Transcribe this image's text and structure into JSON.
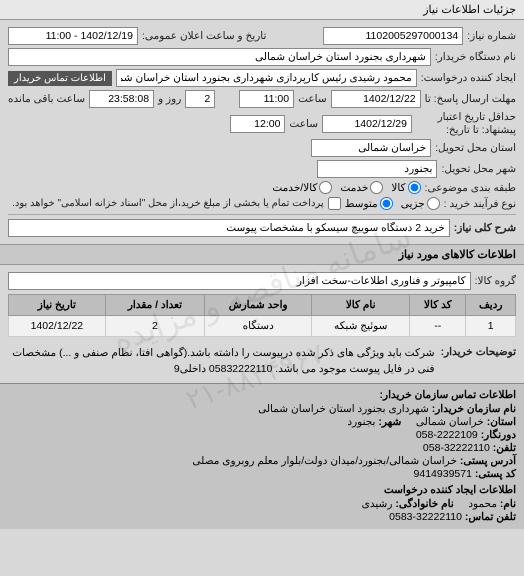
{
  "tab_title": "جزئیات اطلاعات نیاز",
  "header": {
    "num_label": "شماره نیاز:",
    "num_value": "1102005297000134",
    "announce_label": "تاریخ و ساعت اعلان عمومی:",
    "announce_value": "1402/12/19 - 11:00",
    "buyer_label": "نام دستگاه خریدار:",
    "buyer_value": "شهرداری بجنورد استان خراسان شمالی",
    "requester_label": "ایجاد کننده درخواست:",
    "requester_value": "محمود رشیدی رئیس کارپردازی شهرداری بجنورد استان خراسان شمالی",
    "contact_btn": "اطلاعات تماس خریدار",
    "deadline1_label": "مهلت ارسال پاسخ: تا",
    "deadline1_date": "1402/12/22",
    "time_label": "ساعت",
    "deadline1_time": "11:00",
    "remain_days": "2",
    "remain_days_label": "روز و",
    "remain_time": "23:58:08",
    "remain_time_label": "ساعت باقی مانده",
    "deadline2_label": "حداقل تاریخ اعتبار پیشنهاد: تا تاریخ:",
    "deadline2_date": "1402/12/29",
    "deadline2_time": "12:00",
    "province_label": "استان محل تحویل:",
    "province_value": "خراسان شمالی",
    "city_label": "شهر محل تحویل:",
    "city_value": "بجنورد",
    "subject_label": "طبقه بندی موضوعی:",
    "radio_goods": "کالا",
    "radio_service": "خدمت",
    "radio_both": "کالا/خدمت",
    "purchase_type_label": "نوع فرآیند خرید :",
    "radio_partial": "جزیی",
    "radio_medium": "متوسط",
    "purchase_note": "پرداخت تمام یا بخشی از مبلغ خرید،از محل \"اسناد خزانه اسلامی\" خواهد بود.",
    "need_desc_label": "شرح کلی نیاز:",
    "need_desc_value": "خرید 2 دستگاه سوییچ سیسکو با مشخصات پیوست"
  },
  "goods": {
    "section_title": "اطلاعات کالاهای مورد نیاز",
    "group_label": "گروه کالا:",
    "group_value": "کامپیوتر و فناوری اطلاعات-سخت افزار",
    "columns": [
      "ردیف",
      "کد کالا",
      "نام کالا",
      "واحد شمارش",
      "تعداد / مقدار",
      "تاریخ نیاز"
    ],
    "rows": [
      {
        "idx": "1",
        "code": "--",
        "name": "سوئیج شبکه",
        "unit": "دستگاه",
        "qty": "2",
        "date": "1402/12/22"
      }
    ],
    "notes_label": "توضیحات خریدار:",
    "notes_text": "شرکت باید ویژگی های ذکر شده درپیوست را داشته باشد.(گواهی افتا، نظام صنفی و ...) مشخصات فنی در فایل پیوست موجود می باشد. 05832222110 داخلی9"
  },
  "footer": {
    "org_title": "اطلاعات تماس سازمان خریدار:",
    "org_name_label": "نام سازمان خریدار:",
    "org_name": "شهرداری بجنورد استان خراسان شمالی",
    "city_label": "شهر:",
    "city": "بجنورد",
    "province_label": "استان:",
    "province": "خراسان شمالی",
    "fax_label": "دورنگار:",
    "fax": "2222109-058",
    "phone_label": "تلفن:",
    "phone": "32222110-058",
    "address_label": "آدرس پستی:",
    "address": "خراسان شمالی/بجنورد/میدان دولت/بلوار معلم روبروی مصلی",
    "zip_label": "کد پستی:",
    "zip": "9414939571",
    "creator_title": "اطلاعات ایجاد کننده درخواست",
    "fname_label": "نام:",
    "fname": "محمود",
    "lname_label": "نام خانوادگی:",
    "lname": "رشیدی",
    "cphone_label": "تلفن تماس:",
    "cphone": "32222110-0583"
  },
  "watermark1": "سامانه مناقصه و مزایده",
  "watermark2": "۲۱-۸۸۳۴۹۶۷۰"
}
